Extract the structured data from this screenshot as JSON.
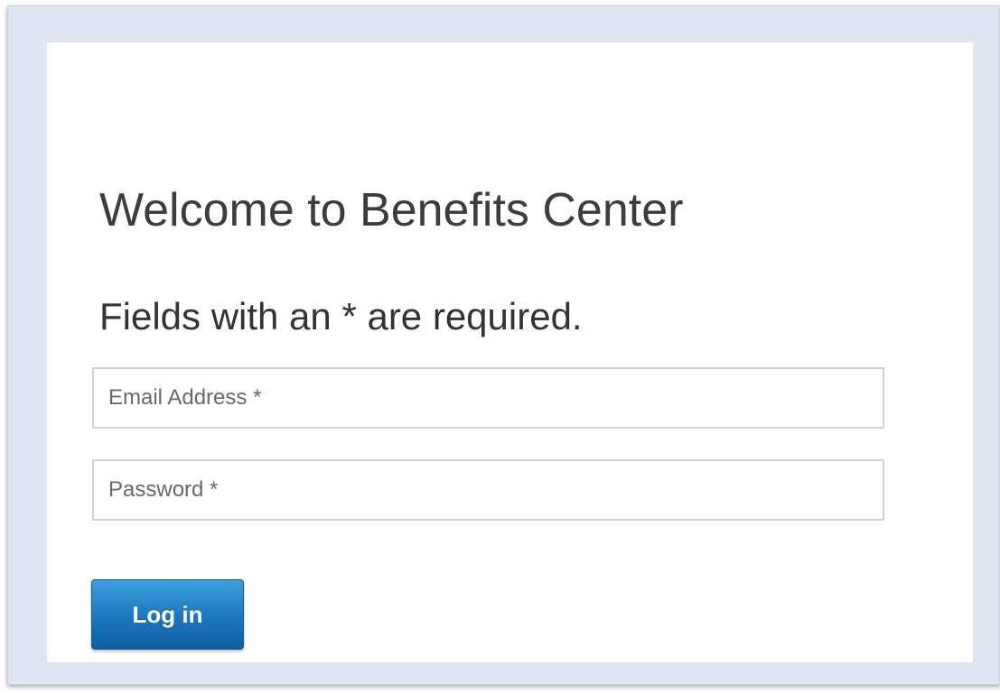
{
  "login": {
    "title": "Welcome to Benefits Center",
    "required_note": "Fields with an * are required.",
    "email": {
      "placeholder": "Email Address *",
      "value": ""
    },
    "password": {
      "placeholder": "Password *",
      "value": ""
    },
    "login_button_label": "Log in",
    "colors": {
      "frame_background": "#dfe6f2",
      "button_top": "#3f9fde",
      "button_bottom": "#0f5ea3",
      "heading_text": "#3b3e41"
    }
  }
}
